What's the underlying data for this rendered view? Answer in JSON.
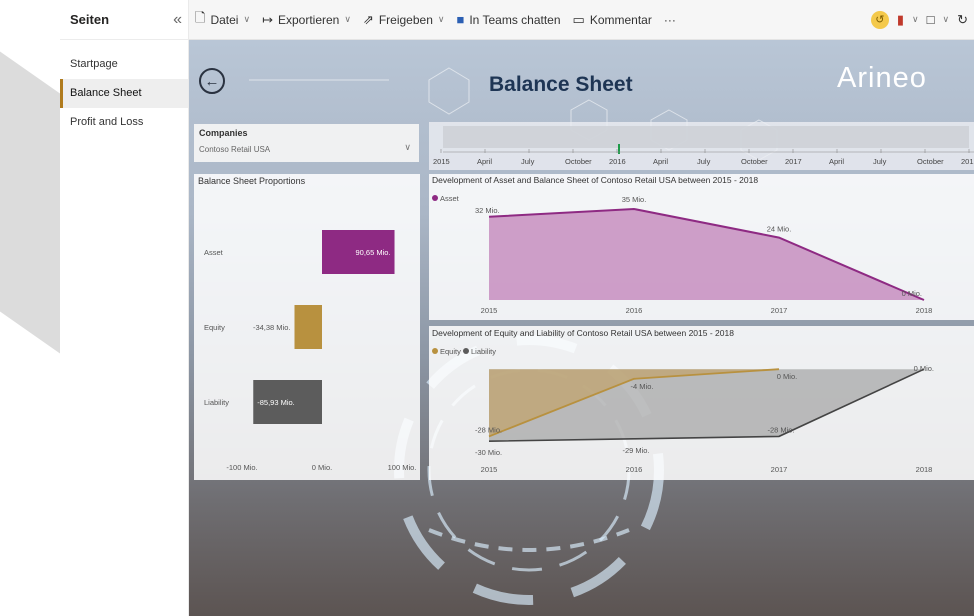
{
  "toolbar": {
    "file": "Datei",
    "export": "Exportieren",
    "share": "Freigeben",
    "teams_chat": "In Teams chatten",
    "comment": "Kommentar",
    "more": "···"
  },
  "pages": {
    "title": "Seiten",
    "items": [
      {
        "label": "Startpage",
        "active": false
      },
      {
        "label": "Balance Sheet",
        "active": true
      },
      {
        "label": "Profit and Loss",
        "active": false
      }
    ]
  },
  "report": {
    "title": "Balance Sheet",
    "logo": "Arineo"
  },
  "slicer": {
    "title": "Companies",
    "value": "Contoso Retail USA"
  },
  "timeline": {
    "ticks": [
      "2015",
      "April",
      "July",
      "October",
      "2016",
      "April",
      "July",
      "October",
      "2017",
      "April",
      "July",
      "October",
      "201"
    ]
  },
  "colors": {
    "asset": "#8e2a83",
    "asset_fill": "#c78ec0",
    "equity": "#b8913f",
    "liability": "#5c5c5c",
    "accent": "#b07b1d"
  },
  "chart_data": [
    {
      "type": "bar",
      "title": "Balance Sheet Proportions",
      "categories": [
        "Asset",
        "Equity",
        "Liability"
      ],
      "values": [
        90.65,
        -34.38,
        -85.93
      ],
      "data_labels": [
        "90,65 Mio.",
        "-34,38 Mio.",
        "-85,93 Mio."
      ],
      "xticks": [
        "-100 Mio.",
        "0 Mio.",
        "100 Mio."
      ],
      "xlim": [
        -100,
        100
      ],
      "colors": [
        "#8e2a83",
        "#b8913f",
        "#5c5c5c"
      ]
    },
    {
      "type": "area",
      "title": "Development of Asset and Balance Sheet of Contoso Retail USA between 2015 - 2018",
      "x": [
        "2015",
        "2016",
        "2017",
        "2018"
      ],
      "series": [
        {
          "name": "Asset",
          "values": [
            32,
            35,
            24,
            0
          ],
          "labels": [
            "32 Mio.",
            "35 Mio.",
            "24 Mio.",
            "0 Mio."
          ]
        }
      ],
      "ylim": [
        0,
        40
      ]
    },
    {
      "type": "area",
      "title": "Development of Equity and Liability of Contoso Retail USA between 2015 - 2018",
      "x": [
        "2015",
        "2016",
        "2017",
        "2018"
      ],
      "series": [
        {
          "name": "Equity",
          "values": [
            -28,
            -4,
            0,
            null
          ],
          "labels": [
            "-28 Mio.",
            "-4 Mio.",
            "0 Mio.",
            ""
          ]
        },
        {
          "name": "Liability",
          "values": [
            -30,
            -29,
            -28,
            0
          ],
          "labels": [
            "-30 Mio.",
            "-29 Mio.",
            "-28 Mio.",
            "0 Mio."
          ]
        }
      ],
      "ylim": [
        -32,
        3
      ]
    }
  ]
}
